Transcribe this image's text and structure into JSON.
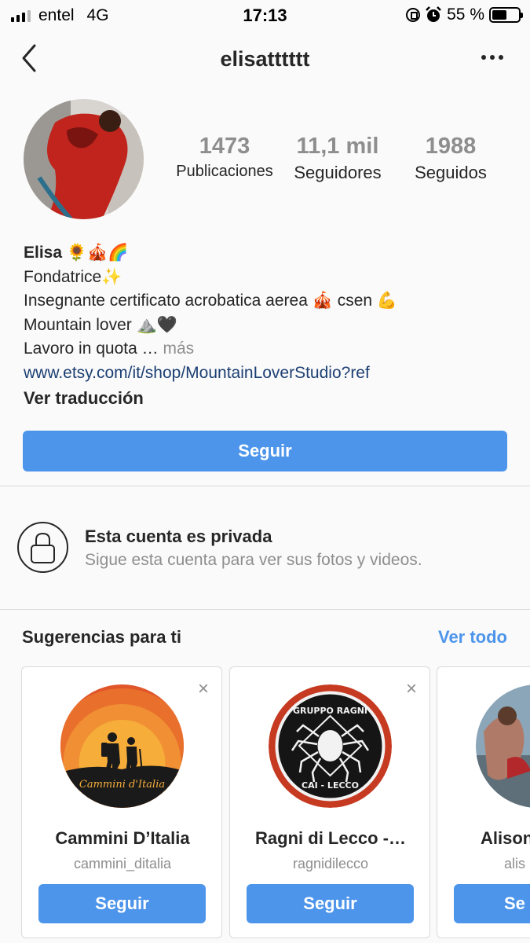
{
  "status_bar": {
    "carrier": "entel",
    "network": "4G",
    "time": "17:13",
    "battery": "55 %",
    "battery_level": 0.55
  },
  "header": {
    "username": "elisatttttt"
  },
  "stats": {
    "posts_count": "1473",
    "posts_label": "Publicaciones",
    "followers_count": "11,1 mil",
    "followers_label": "Seguidores",
    "following_count": "1988",
    "following_label": "Seguidos"
  },
  "bio": {
    "name": "Elisa 🌻🎪🌈",
    "line1": "Fondatrice✨",
    "line2": "Insegnante certificato acrobatica aerea 🎪 csen 💪",
    "line3": "Mountain lover ⛰️🖤",
    "line4": "Lavoro in quota …",
    "more": "más",
    "link": "www.etsy.com/it/shop/MountainLoverStudio?ref",
    "translate": "Ver traducción"
  },
  "follow_button": "Seguir",
  "private_notice": {
    "title": "Esta cuenta es privada",
    "subtitle": "Sigue esta cuenta para ver sus fotos y videos."
  },
  "suggestions": {
    "heading": "Sugerencias para ti",
    "see_all": "Ver todo",
    "close_icon": "×",
    "cards": [
      {
        "name": "Cammini D’Italia",
        "username": "cammini_ditalia",
        "button": "Seguir",
        "logo_text": "Cammini d'Italia"
      },
      {
        "name": "Ragni di Lecco -…",
        "username": "ragnidilecco",
        "button": "Seguir",
        "logo_text_top": "GRUPPO RAGNI",
        "logo_text_bottom": "CAI - LECCO"
      },
      {
        "name": "Alison",
        "username": "alis",
        "button": "Se"
      }
    ]
  },
  "icons": {
    "back": "chevron-left-icon",
    "more": "more-dots-icon",
    "lock": "lock-icon",
    "close": "close-icon"
  },
  "colors": {
    "accent": "#4d95eb",
    "link": "#1c3f73",
    "muted": "#8e8e8e"
  }
}
